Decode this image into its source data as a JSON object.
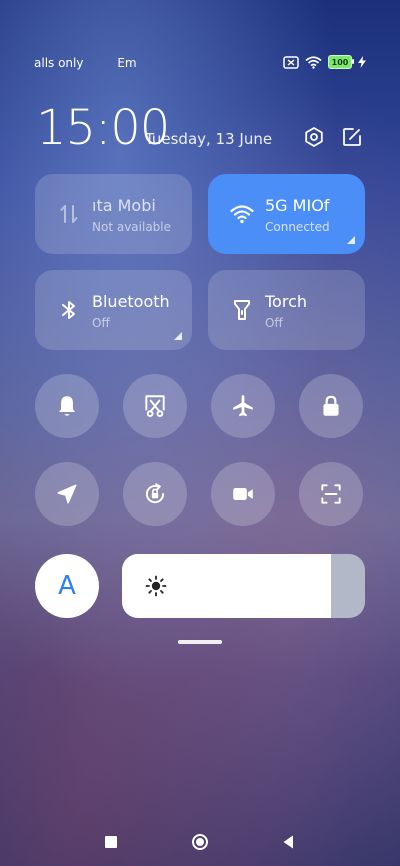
{
  "status_bar": {
    "left_texts": [
      "alls only",
      "Em"
    ],
    "battery": "100",
    "icons": [
      "sim-off-icon",
      "wifi-icon",
      "battery-icon",
      "charging-icon"
    ]
  },
  "header": {
    "time": "15:00",
    "date": "Tuesday, 13 June",
    "icons": [
      "settings-icon",
      "edit-icon"
    ]
  },
  "tiles": [
    {
      "title": "ıta    Mobi",
      "subtitle": "Not available",
      "icon": "data-arrows-icon",
      "active": false
    },
    {
      "title": "5G    MIOf",
      "subtitle": "Connected",
      "icon": "wifi-icon",
      "active": true
    },
    {
      "title": "Bluetooth",
      "subtitle": "Off",
      "icon": "bluetooth-icon",
      "active": false
    },
    {
      "title": "Torch",
      "subtitle": "Off",
      "icon": "torch-icon",
      "active": false
    }
  ],
  "toggles": [
    "bell-icon",
    "screenshot-icon",
    "airplane-icon",
    "lock-icon",
    "location-icon",
    "rotation-lock-icon",
    "video-icon",
    "scan-icon"
  ],
  "brightness": {
    "auto_label": "A",
    "level": 0.86
  },
  "colors": {
    "accent": "#4c8ef7",
    "auto_text": "#2f7ff0",
    "battery": "#7dea6c"
  },
  "nav_icons": [
    "recents-icon",
    "home-icon",
    "back-icon"
  ]
}
